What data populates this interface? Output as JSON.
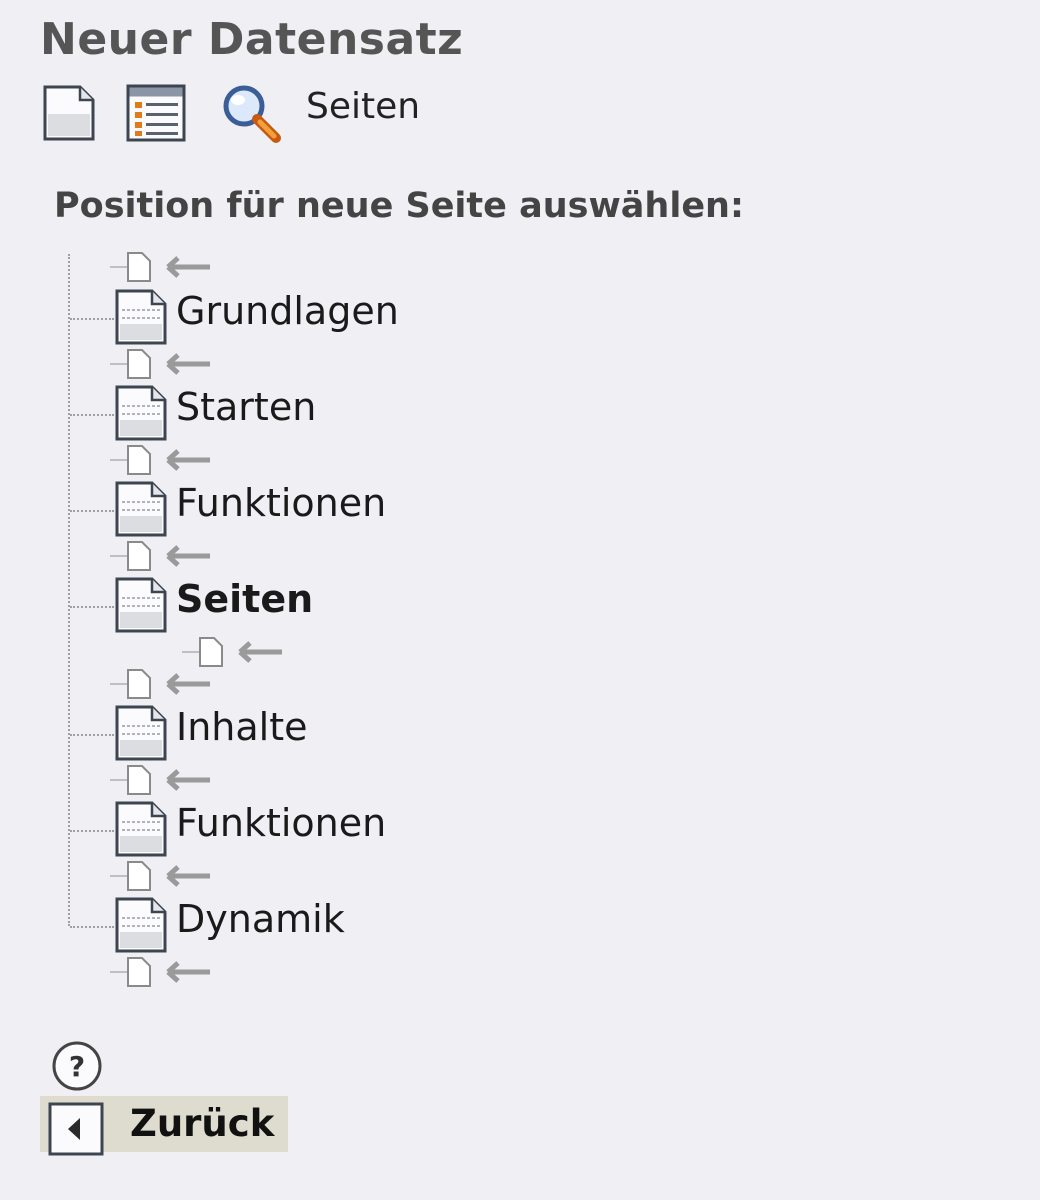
{
  "header": {
    "title": "Neuer Datensatz"
  },
  "toolbar": {
    "icons": [
      "new-page-icon",
      "list-view-icon",
      "search-icon"
    ],
    "page_label": "Seiten"
  },
  "position_picker": {
    "heading": "Position für neue Seite auswählen:",
    "pages": [
      {
        "label": "Grundlagen",
        "current": false
      },
      {
        "label": "Starten",
        "current": false
      },
      {
        "label": "Funktionen",
        "current": false
      },
      {
        "label": "Seiten",
        "current": true
      },
      {
        "label": "Inhalte",
        "current": false
      },
      {
        "label": "Funktionen",
        "current": false
      },
      {
        "label": "Dynamik",
        "current": false
      }
    ]
  },
  "footer": {
    "help_icon": "help-icon",
    "back_label": "Zurück"
  }
}
